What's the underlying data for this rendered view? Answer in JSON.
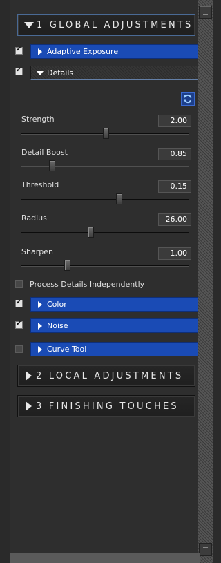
{
  "sections": {
    "global": "1 GLOBAL ADJUSTMENTS",
    "local": "2 LOCAL ADJUSTMENTS",
    "finishing": "3 FINISHING TOUCHES"
  },
  "tools": {
    "adaptive_exposure": "Adaptive Exposure",
    "details": "Details",
    "color": "Color",
    "noise": "Noise",
    "curve_tool": "Curve Tool"
  },
  "checkbox_states": {
    "adaptive_exposure": true,
    "details": true,
    "process_details_independently": false,
    "color": true,
    "noise": true,
    "curve_tool": false
  },
  "details_panel": {
    "refresh_icon": "refresh-icon",
    "sliders": [
      {
        "label": "Strength",
        "value": "2.00",
        "position": 0.5
      },
      {
        "label": "Detail Boost",
        "value": "0.85",
        "position": 0.18
      },
      {
        "label": "Threshold",
        "value": "0.15",
        "position": 0.58
      },
      {
        "label": "Radius",
        "value": "26.00",
        "position": 0.41
      },
      {
        "label": "Sharpen",
        "value": "1.00",
        "position": 0.27
      }
    ],
    "process_independently_label": "Process Details Independently"
  },
  "colors": {
    "accent_blue": "#1a4bb5",
    "panel_bg": "#2e2e2e"
  }
}
